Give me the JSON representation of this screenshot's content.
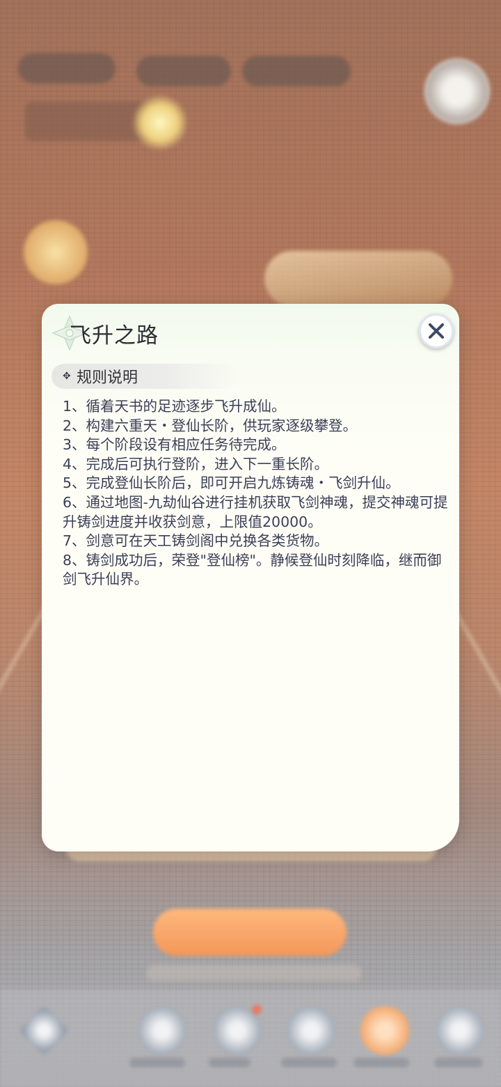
{
  "modal": {
    "title": "飞升之路",
    "section_label": "规则说明",
    "section_icon": "sparkle-icon",
    "close_icon": "close-icon",
    "rules": [
      "1、循着天书的足迹逐步飞升成仙。",
      "2、构建六重天・登仙长阶，供玩家逐级攀登。",
      "3、每个阶段设有相应任务待完成。",
      "4、完成后可执行登阶，进入下一重长阶。",
      "5、完成登仙长阶后，即可开启九炼铸魂・飞剑升仙。",
      "6、通过地图-九劫仙谷进行挂机获取飞剑神魂，提交神魂可提升铸剑进度并收获剑意，上限值20000。",
      "7、剑意可在天工铸剑阁中兑换各类货物。",
      "8、铸剑成功后，荣登\"登仙榜\"。静候登仙时刻降临，继而御剑飞升仙界。"
    ]
  },
  "colors": {
    "modal_bg": "#fefef7",
    "title_text": "#2c2c33",
    "rule_text": "#3b3f57",
    "bg_primary": "#9e5331",
    "accent_orange": "#f07a2a"
  }
}
